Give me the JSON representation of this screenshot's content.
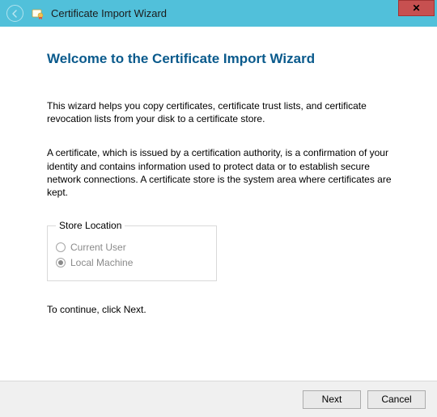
{
  "titlebar": {
    "title": "Certificate Import Wizard"
  },
  "content": {
    "heading": "Welcome to the Certificate Import Wizard",
    "para1": "This wizard helps you copy certificates, certificate trust lists, and certificate revocation lists from your disk to a certificate store.",
    "para2": "A certificate, which is issued by a certification authority, is a confirmation of your identity and contains information used to protect data or to establish secure network connections. A certificate store is the system area where certificates are kept.",
    "store_legend": "Store Location",
    "radio_current_user": "Current User",
    "radio_local_machine": "Local Machine",
    "continue_hint": "To continue, click Next."
  },
  "footer": {
    "next_label": "Next",
    "cancel_label": "Cancel"
  }
}
